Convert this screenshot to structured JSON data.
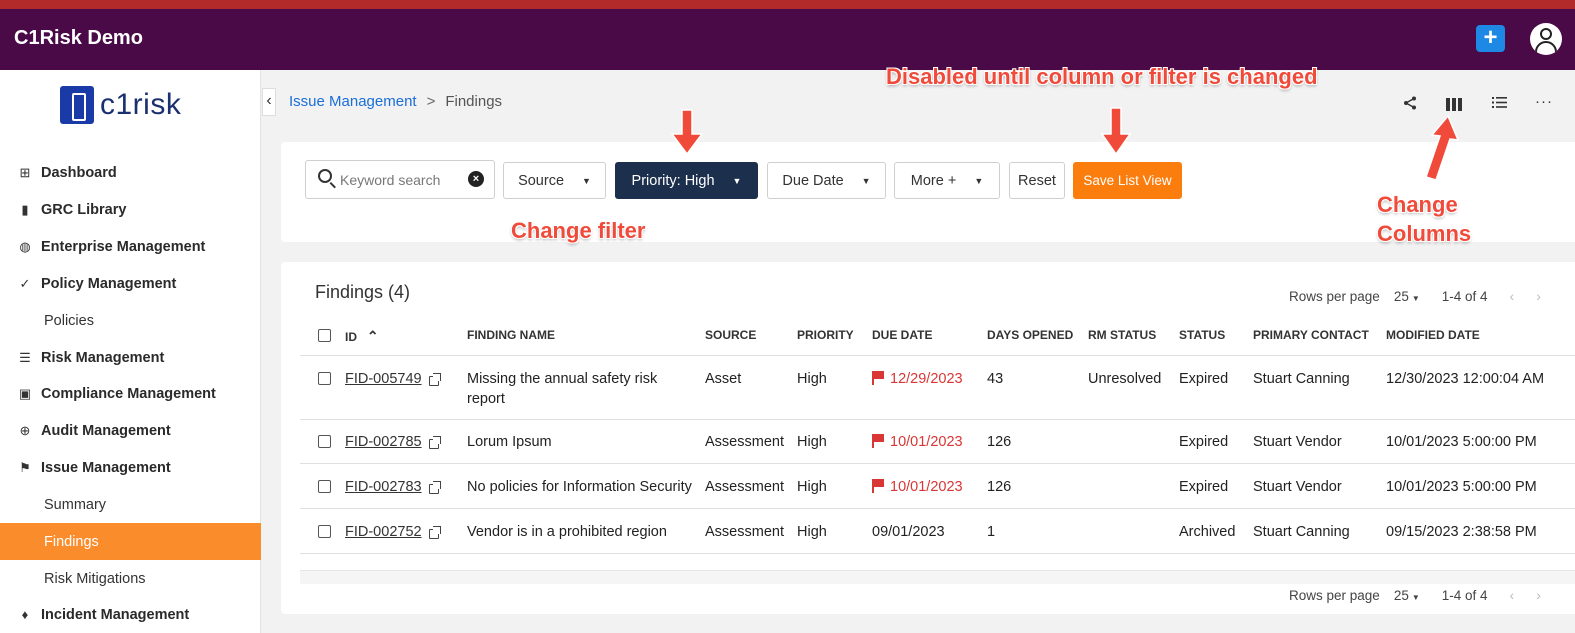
{
  "app": {
    "title": "C1Risk Demo",
    "logo_text": "c1risk"
  },
  "sidebar": {
    "items": [
      {
        "label": "Dashboard",
        "icon": "grid-icon"
      },
      {
        "label": "GRC Library",
        "icon": "book-icon"
      },
      {
        "label": "Enterprise Management",
        "icon": "globe-icon"
      },
      {
        "label": "Policy Management",
        "icon": "double-check-icon"
      },
      {
        "label": "Policies",
        "sub": true
      },
      {
        "label": "Risk Management",
        "icon": "list-icon"
      },
      {
        "label": "Compliance Management",
        "icon": "clipboard-check-icon"
      },
      {
        "label": "Audit Management",
        "icon": "crosshair-icon"
      },
      {
        "label": "Issue Management",
        "icon": "flag-icon"
      },
      {
        "label": "Summary",
        "sub": true
      },
      {
        "label": "Findings",
        "sub": true,
        "active": true
      },
      {
        "label": "Risk Mitigations",
        "sub": true
      },
      {
        "label": "Incident Management",
        "icon": "drop-icon"
      }
    ]
  },
  "breadcrumb": {
    "parent": "Issue Management",
    "separator": ">",
    "current": "Findings"
  },
  "filters": {
    "search_placeholder": "Keyword search",
    "source": "Source",
    "priority": "Priority: High",
    "due_date": "Due Date",
    "more": "More +",
    "reset": "Reset",
    "save": "Save List View"
  },
  "annotations": {
    "disabled_note": "Disabled until column or filter is changed",
    "change_filter": "Change filter",
    "change_columns_1": "Change",
    "change_columns_2": "Columns"
  },
  "table": {
    "title": "Findings (4)",
    "rows_per_page_label": "Rows per page",
    "rows_per_page_value": "25",
    "range": "1-4 of 4",
    "columns": [
      "ID",
      "FINDING NAME",
      "SOURCE",
      "PRIORITY",
      "DUE DATE",
      "DAYS OPENED",
      "RM STATUS",
      "STATUS",
      "PRIMARY CONTACT",
      "MODIFIED DATE"
    ],
    "rows": [
      {
        "id": "FID-005749",
        "name": "Missing the annual safety risk",
        "name2": "report",
        "source": "Asset",
        "priority": "High",
        "due": "12/29/2023",
        "overdue": true,
        "days": "43",
        "rm_status": "Unresolved",
        "status": "Expired",
        "contact": "Stuart Canning",
        "modified": "12/30/2023 12:00:04 AM"
      },
      {
        "id": "FID-002785",
        "name": "Lorum Ipsum",
        "name2": "",
        "source": "Assessment",
        "priority": "High",
        "due": "10/01/2023",
        "overdue": true,
        "days": "126",
        "rm_status": "",
        "status": "Expired",
        "contact": "Stuart Vendor",
        "modified": "10/01/2023 5:00:00 PM"
      },
      {
        "id": "FID-002783",
        "name": "No policies for Information Security",
        "name2": "",
        "source": "Assessment",
        "priority": "High",
        "due": "10/01/2023",
        "overdue": true,
        "days": "126",
        "rm_status": "",
        "status": "Expired",
        "contact": "Stuart Vendor",
        "modified": "10/01/2023 5:00:00 PM"
      },
      {
        "id": "FID-002752",
        "name": "Vendor is in a prohibited region",
        "name2": "",
        "source": "Assessment",
        "priority": "High",
        "due": "09/01/2023",
        "overdue": false,
        "days": "1",
        "rm_status": "",
        "status": "Archived",
        "contact": "Stuart Canning",
        "modified": "09/15/2023 2:38:58 PM"
      }
    ]
  },
  "colors": {
    "topbar": "#4a0a47",
    "accent": "#fb8c2b",
    "save_button": "#fb7d0d",
    "priority_button": "#1c2f4d",
    "overdue": "#d93636",
    "annotation": "#f04a3a"
  }
}
